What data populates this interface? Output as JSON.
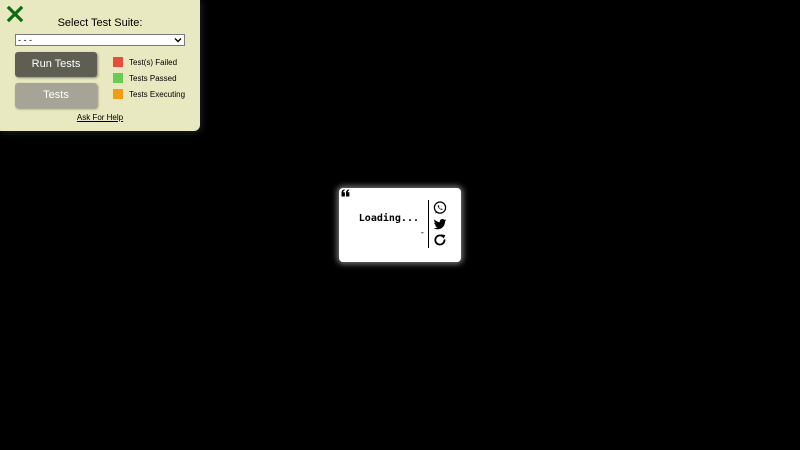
{
  "test_panel": {
    "title": "Select Test Suite:",
    "select_value": "- - -",
    "run_button": "Run Tests",
    "tests_button": "Tests",
    "legend": [
      {
        "label": "Test(s) Failed",
        "color": "#e94c3c"
      },
      {
        "label": "Tests Passed",
        "color": "#66cc52"
      },
      {
        "label": "Tests Executing",
        "color": "#f39c12"
      }
    ],
    "help_link": "Ask For Help",
    "close_icon_color": "#0e6a0e"
  },
  "quote_box": {
    "text": "Loading...",
    "author": "-",
    "icons": [
      "quote-icon",
      "whatsapp-icon",
      "twitter-icon",
      "refresh-icon"
    ]
  }
}
